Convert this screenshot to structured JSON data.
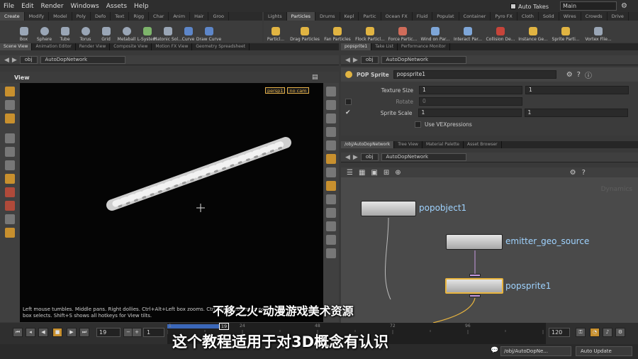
{
  "menu": [
    "File",
    "Edit",
    "Render",
    "Windows",
    "Assets",
    "Help"
  ],
  "takes_label": "Auto Takes",
  "desktop": "Main",
  "shelf_left": {
    "tabs": [
      "Create",
      "Modify",
      "Model",
      "Poly",
      "Defo",
      "Text",
      "Rigg",
      "Char",
      "Anim",
      "Hair",
      "Groo"
    ],
    "tools": [
      "Box",
      "Sphere",
      "Tube",
      "Torus",
      "Grid",
      "Metaball",
      "L-System",
      "Platonic Sol...",
      "Curve",
      "Draw Curve"
    ]
  },
  "shelf_right": {
    "tabs": [
      "Lights",
      "Particles",
      "Drums",
      "Kepl",
      "Partic",
      "Ocean FX",
      "Fluid",
      "Populat",
      "Container",
      "Pyro FX",
      "Cloth",
      "Solid",
      "Wires",
      "Crowds",
      "Drive"
    ],
    "tools": [
      "Particl...",
      "Drag Particles",
      "Fan Particles",
      "Flock Particl...",
      "Force Partic...",
      "Wind on Par...",
      "Interact Par...",
      "Collision De...",
      "Instance Ge...",
      "Sprite Parti...",
      "Vortex Flie..."
    ]
  },
  "left_tabs": [
    "Scene View",
    "Animation Editor",
    "Render View",
    "Composite View",
    "Motion FX View",
    "Geometry Spreadsheet"
  ],
  "left_path": {
    "obj": "obj",
    "net": "AutoDopNetwork"
  },
  "view": {
    "title": "View",
    "persp": "persp1",
    "cam": "no cam"
  },
  "hint": "Left mouse tumbles. Middle pans. Right dollies. Ctrl+Alt+Left box zooms. Ctrl+Right zooms to point. Ctrl+Shift+Left box selects. Shift+S shows all hotkeys for View tilts.",
  "right_tabs": [
    "popsprite1",
    "Take List",
    "Performance Monitor"
  ],
  "right_path": {
    "obj": "obj",
    "net": "AutoDopNetwork"
  },
  "params": {
    "type": "POP Sprite",
    "name": "popsprite1",
    "rows": [
      {
        "label": "Texture Size",
        "v1": "1",
        "v2": "1"
      },
      {
        "label": "Rotate",
        "v1": "0",
        "v2": ""
      },
      {
        "label": "Sprite Scale",
        "v1": "1",
        "v2": "1"
      }
    ],
    "vex_label": "Use VEXpressions"
  },
  "net_tabs": [
    "/obj/AutoDopNetwork",
    "Tree View",
    "Material Palette",
    "Asset Browser"
  ],
  "net_path": {
    "obj": "obj",
    "net": "AutoDopNetwork"
  },
  "net_watermark": "Dynamics",
  "nodes": {
    "a": "popobject1",
    "b": "emitter_geo_source",
    "c": "popsprite1"
  },
  "timeline": {
    "frame": "19",
    "start": "1",
    "end": "120",
    "ticks": [
      "1",
      "19",
      "24",
      "48",
      "72",
      "96",
      "120"
    ]
  },
  "status": {
    "path": "/obj/AutoDopNe...",
    "update": "Auto Update"
  },
  "subtitles": {
    "line1": "不移之火-动漫游戏美术资源",
    "line2": "这个教程适用于对3D概念有认识"
  },
  "colors": {
    "accent": "#e9b53e",
    "node_label": "#9fd3ff",
    "dock": "#c69be0",
    "timeline": "#3b67b8"
  }
}
